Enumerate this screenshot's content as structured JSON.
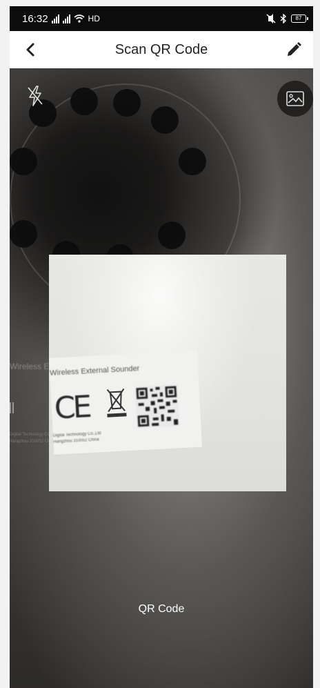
{
  "status_bar": {
    "time": "16:32",
    "network": "HD",
    "battery": "87"
  },
  "header": {
    "title": "Scan QR Code"
  },
  "icons": {
    "back": "chevron-left-icon",
    "edit": "pencil-icon",
    "flash": "flash-off-icon",
    "gallery": "image-icon",
    "wifi": "wifi-icon",
    "bluetooth": "bluetooth-icon",
    "mute": "mute-icon"
  },
  "camera": {
    "sticker_title": "Wireless External Sounder",
    "sticker_line1": "Digital Technology Co.,Ltd",
    "sticker_line2": "Hangzhou 310052 China",
    "ce_mark": "CE"
  },
  "mode_label": "QR Code",
  "colors": {
    "header_bg": "#ffffff",
    "status_bg": "#0c0c0c",
    "camera_bg": "#3a3836"
  }
}
